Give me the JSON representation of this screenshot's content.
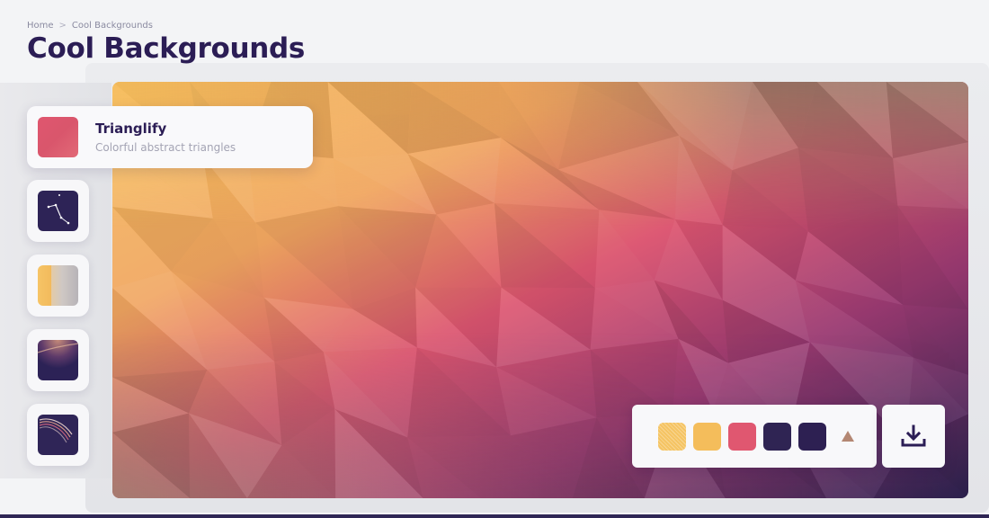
{
  "breadcrumb": {
    "items": [
      "Home",
      "Cool Backgrounds"
    ],
    "separator": ">"
  },
  "page": {
    "title": "Cool Backgrounds"
  },
  "generators": [
    {
      "title": "Trianglify",
      "subtitle": "Colorful abstract triangles",
      "selected": true,
      "icon": "trianglify-swatch-icon"
    },
    {
      "icon": "constellation-swatch-icon"
    },
    {
      "icon": "gradient-topography-swatch-icon"
    },
    {
      "icon": "blurry-gradient-swatch-icon"
    },
    {
      "icon": "swirl-swatch-icon"
    }
  ],
  "palette": {
    "colors": [
      "#f5c463",
      "#f4bd5b",
      "#e05770",
      "#2f2453",
      "#2d2052"
    ],
    "first_chip_style": "dotted",
    "add_icon": "triangle-icon"
  },
  "download": {
    "icon": "download-icon"
  },
  "colors": {
    "title": "#2b1d55",
    "preview_top_left": "#f5bd5c",
    "preview_center": "#dc5570",
    "preview_bottom_right": "#2f2453"
  }
}
